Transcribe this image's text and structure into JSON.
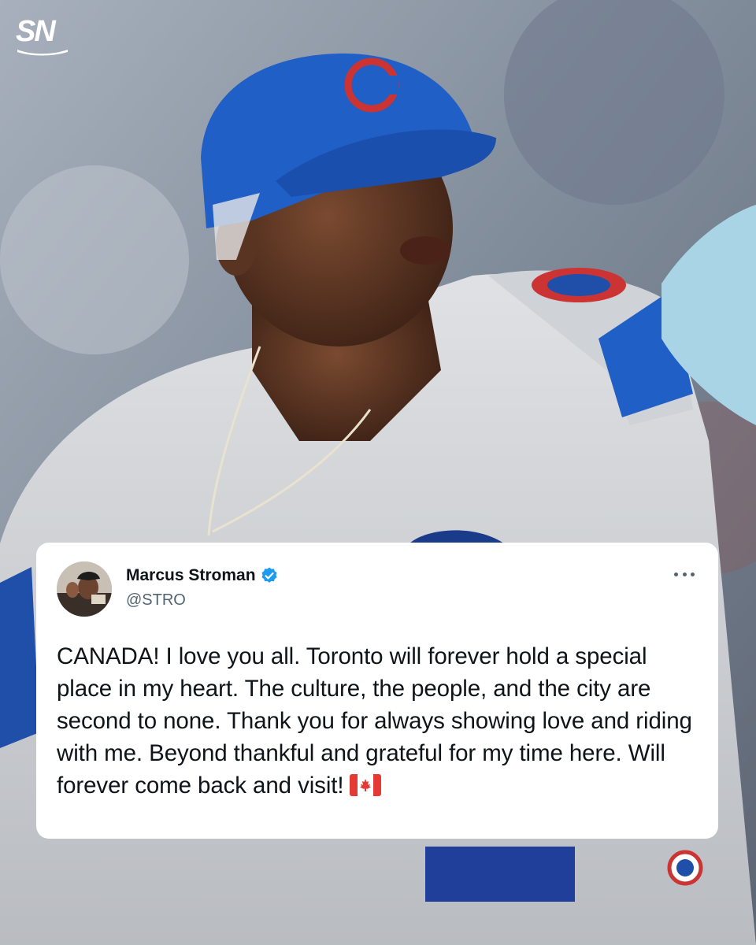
{
  "brand": {
    "logo_text": "SN"
  },
  "tweet": {
    "display_name": "Marcus Stroman",
    "handle": "@STRO",
    "verified": true,
    "text": "CANADA! I love you all. Toronto will forever hold a special place in my heart. The culture, the people, and the city are second to none. Thank you for always showing love and riding with me. Beyond thankful and grateful for my time here. Will forever come back and visit!",
    "trailing_emoji": "canada-flag-icon"
  },
  "colors": {
    "cap_blue": "#1f5fc6",
    "logo_red": "#cc3433",
    "verified_blue": "#1d9bf0",
    "jersey_gray": "#d7d9dc"
  }
}
